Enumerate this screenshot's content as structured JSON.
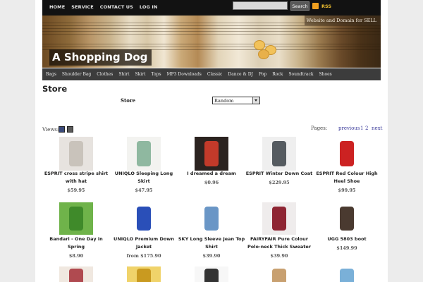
{
  "topnav": {
    "links": [
      "HOME",
      "SERVICE",
      "CONTACT US",
      "LOG IN"
    ],
    "search_button": "Search",
    "rss_label": "RSS"
  },
  "banner": {
    "title": "A Shopping Dog",
    "ad_text": "Website and Domain for SELL"
  },
  "categories": [
    "Bags",
    "Shoulder Bag",
    "Clothes",
    "Shirt",
    "Skirt",
    "Tops",
    "MP3 Downloads",
    "Classic",
    "Dance & DJ",
    "Pop",
    "Rock",
    "Soundtrack",
    "Shoes"
  ],
  "store": {
    "title": "Store",
    "sort_label": "Store",
    "sort_value": "Random",
    "views_label": "Views:",
    "pages_label": "Pages:",
    "pager": [
      "previous",
      "1",
      "2",
      "next"
    ]
  },
  "products": [
    {
      "name_lines": [
        "ESPRIT cross stripe shirt",
        "with hat"
      ],
      "price": "$59.95",
      "thumb_color": "#e7e3df",
      "accent": "#c9c3bb"
    },
    {
      "name_lines": [
        "UNIQLO Sleeping Long",
        "Skirt"
      ],
      "price": "$47.95",
      "thumb_color": "#f3f3f0",
      "accent": "#8fb8a0"
    },
    {
      "name_lines": [
        "I dreamed a dream"
      ],
      "price": "$0.96",
      "thumb_color": "#2b2320",
      "accent": "#c23a2a"
    },
    {
      "name_lines": [
        "ESPRIT Winter Down Coat"
      ],
      "price": "$229.95",
      "thumb_color": "#efefef",
      "accent": "#555b60"
    },
    {
      "name_lines": [
        "ESPRIT Red Colour High",
        "Heel Shoe"
      ],
      "price": "$99.95",
      "thumb_color": "#ffffff",
      "accent": "#cc2222"
    },
    {
      "name_lines": [
        "Bandari - One Day in",
        "Spring"
      ],
      "price": "$8.90",
      "thumb_color": "#6fb34a",
      "accent": "#3f8a2a"
    },
    {
      "name_lines": [
        "UNIQLO Premium Down",
        "Jacket"
      ],
      "price": "from $175.90",
      "thumb_color": "#ffffff",
      "accent": "#2a4fb8"
    },
    {
      "name_lines": [
        "SKY Long Sleeve Jean Top",
        "Shirt"
      ],
      "price": "$39.90",
      "thumb_color": "#ffffff",
      "accent": "#6a96c6"
    },
    {
      "name_lines": [
        "FAIRYFAIR Pure Colour",
        "Polo-neck Thick Sweater"
      ],
      "price": "$39.90",
      "thumb_color": "#efecec",
      "accent": "#8e2533"
    },
    {
      "name_lines": [
        "UGG 5803 boot"
      ],
      "price": "$149.99",
      "thumb_color": "#ffffff",
      "accent": "#4a3a30"
    }
  ],
  "bottom_thumbs": [
    {
      "thumb_color": "#f0e8e0",
      "accent": "#b04a50"
    },
    {
      "thumb_color": "#f0d36a",
      "accent": "#c99a20"
    },
    {
      "thumb_color": "#f7f7f7",
      "accent": "#333333"
    },
    {
      "thumb_color": "#ffffff",
      "accent": "#c8a070"
    },
    {
      "thumb_color": "#ffffff",
      "accent": "#7ab0d8"
    }
  ]
}
